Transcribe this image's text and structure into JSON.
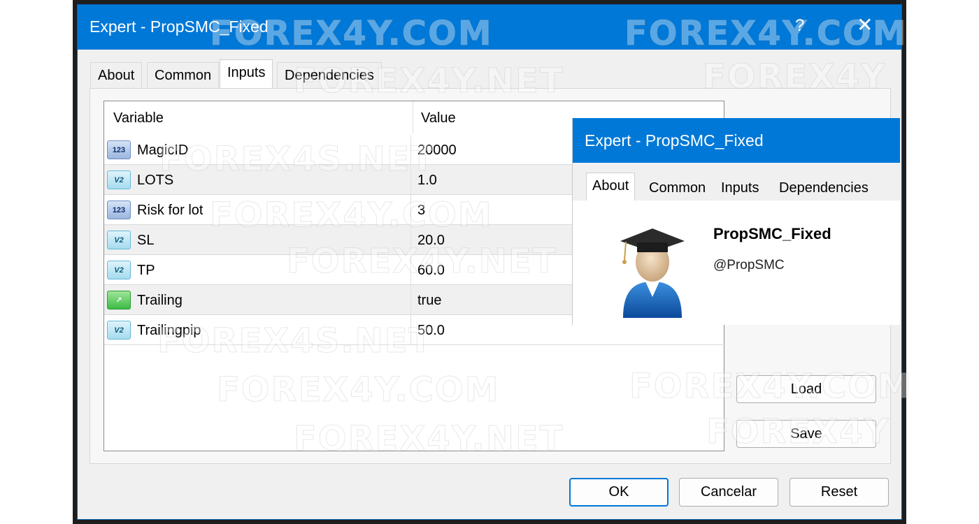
{
  "window": {
    "title": "Expert - PropSMC_Fixed",
    "help_glyph": "?",
    "close_glyph": "✕"
  },
  "tabs": [
    {
      "label": "About"
    },
    {
      "label": "Common"
    },
    {
      "label": "Inputs"
    },
    {
      "label": "Dependencies"
    }
  ],
  "grid": {
    "headers": {
      "variable": "Variable",
      "value": "Value"
    },
    "rows": [
      {
        "name": "MagicID",
        "value": "20000",
        "type_icon": "int-icon",
        "icon_text": "123"
      },
      {
        "name": "LOTS",
        "value": "1.0",
        "type_icon": "double-icon",
        "icon_text": "V2"
      },
      {
        "name": "Risk for lot",
        "value": "3",
        "type_icon": "int-icon",
        "icon_text": "123"
      },
      {
        "name": "SL",
        "value": "20.0",
        "type_icon": "double-icon",
        "icon_text": "V2"
      },
      {
        "name": "TP",
        "value": "60.0",
        "type_icon": "double-icon",
        "icon_text": "V2"
      },
      {
        "name": "Trailing",
        "value": "true",
        "type_icon": "bool-icon",
        "icon_text": "↗"
      },
      {
        "name": "Trailingpip",
        "value": "50.0",
        "type_icon": "double-icon",
        "icon_text": "V2"
      }
    ]
  },
  "side_buttons": {
    "load": "Load",
    "save": "Save"
  },
  "footer_buttons": {
    "ok": "OK",
    "cancel": "Cancelar",
    "reset": "Reset"
  },
  "popup": {
    "title": "Expert - PropSMC_Fixed",
    "tabs": [
      "About",
      "Common",
      "Inputs",
      "Dependencies"
    ],
    "expert_name": "PropSMC_Fixed",
    "author": "@PropSMC"
  },
  "watermarks": [
    "FOREX4Y.COM",
    "FOREX4Y.COM",
    "FOREX4Y",
    "FOREX4Y.NET",
    "FOREX4S.NET",
    "FOREX4Y.COM",
    "FOREX4Y.NET",
    "FOREX4S.NET",
    "FOREX4Y.COM",
    "FOREX4Y.NET",
    "FOREX4Y.COM",
    "FOREX4Y"
  ],
  "colors": {
    "accent": "#0078d7",
    "window_bg": "#f0f0f0"
  }
}
